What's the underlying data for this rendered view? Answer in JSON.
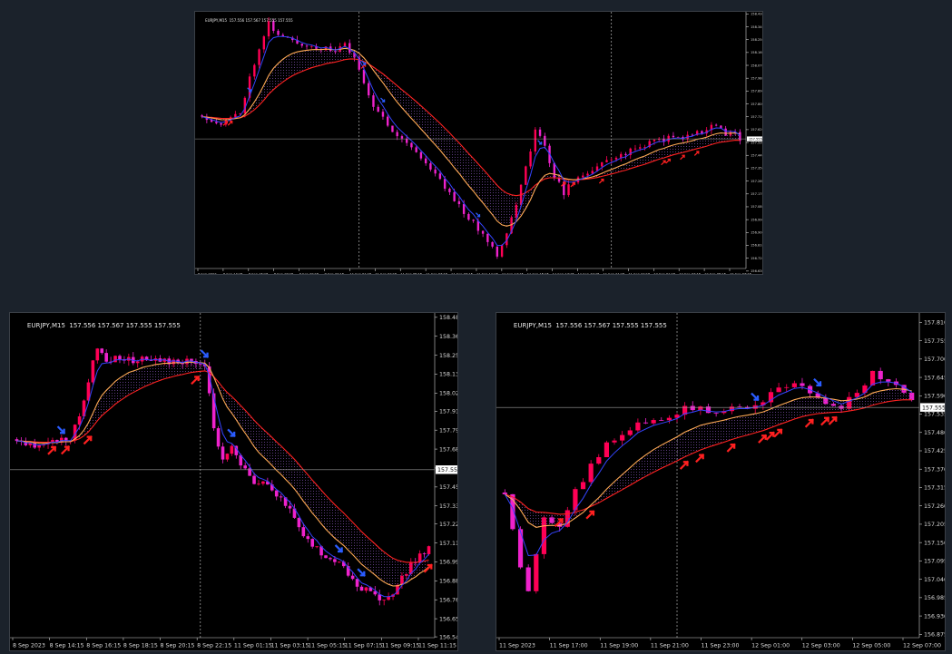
{
  "header": {
    "symbol": "EURJPY,M15",
    "quote": "157.556 157.567 157.555 157.555"
  },
  "colors": {
    "background": "#000000",
    "page": "#1b222b",
    "bull_candle": "#ff0055",
    "bear_candle": "#ee22cc",
    "ema_fast": "#3344ff",
    "ema_mid": "#ffaa55",
    "ema_slow": "#ff2222",
    "arrow_up": "#ff2020",
    "arrow_down": "#2a5cff",
    "price_line": "#9a9a9a",
    "separator": "#cfcfcf"
  },
  "chart_data": [
    {
      "type": "candlestick",
      "panel": "top",
      "title": "EURJPY,M15  157.556 157.567 157.555 157.555",
      "ylim": [
        156.648,
        158.432
      ],
      "yticks": [
        "158.430",
        "158.340",
        "158.250",
        "158.160",
        "158.070",
        "157.980",
        "157.890",
        "157.800",
        "157.710",
        "157.620",
        "157.530",
        "157.440",
        "157.350",
        "157.260",
        "157.170",
        "157.080",
        "156.990",
        "156.900",
        "156.810",
        "156.720",
        "156.630",
        "156.540"
      ],
      "xticks": [
        "8 Sep 2023",
        "8 Sep 14:15",
        "8 Sep 16:15",
        "8 Sep 18:15",
        "8 Sep 20:15",
        "8 Sep 22:15",
        "11 Sep 01:15",
        "11 Sep 03:15",
        "11 Sep 05:15",
        "11 Sep 07:15",
        "11 Sep 09:15",
        "11 Sep 11:15",
        "11 Sep 13:15",
        "11 Sep 15:15",
        "11 Sep 17:15",
        "11 Sep 19:15",
        "11 Sep 21:15",
        "11 Sep 23:15",
        "12 Sep 01:15",
        "12 Sep 03:15",
        "12 Sep 05:15",
        "12 Sep 07:15"
      ],
      "current_price": "157.555",
      "price_path": [
        [
          0,
          157.72
        ],
        [
          4,
          157.66
        ],
        [
          8,
          157.74
        ],
        [
          10,
          157.98
        ],
        [
          12,
          158.2
        ],
        [
          14,
          158.37
        ],
        [
          16,
          158.28
        ],
        [
          19,
          158.24
        ],
        [
          22,
          158.21
        ],
        [
          25,
          158.19
        ],
        [
          28,
          158.17
        ],
        [
          30,
          158.22
        ],
        [
          33,
          158.05
        ],
        [
          36,
          157.78
        ],
        [
          40,
          157.62
        ],
        [
          44,
          157.5
        ],
        [
          48,
          157.35
        ],
        [
          52,
          157.18
        ],
        [
          56,
          157.0
        ],
        [
          60,
          156.85
        ],
        [
          62,
          156.75
        ],
        [
          64,
          156.9
        ],
        [
          66,
          157.1
        ],
        [
          68,
          157.35
        ],
        [
          70,
          157.62
        ],
        [
          72,
          157.5
        ],
        [
          74,
          157.3
        ],
        [
          76,
          157.18
        ],
        [
          78,
          157.26
        ],
        [
          82,
          157.34
        ],
        [
          86,
          157.42
        ],
        [
          90,
          157.47
        ],
        [
          94,
          157.53
        ],
        [
          98,
          157.56
        ],
        [
          102,
          157.57
        ],
        [
          104,
          157.6
        ],
        [
          106,
          157.62
        ],
        [
          108,
          157.66
        ],
        [
          110,
          157.58
        ],
        [
          112,
          157.59
        ],
        [
          113,
          157.56
        ]
      ],
      "separators": [
        33,
        86
      ],
      "markers_up": [
        5,
        6,
        34,
        76,
        78,
        84,
        97,
        98,
        101,
        104
      ],
      "markers_down": [
        10,
        34,
        38,
        58,
        71
      ]
    },
    {
      "type": "candlestick",
      "panel": "bottom-left",
      "title": "EURJPY,M15  157.556 157.567 157.555 157.555",
      "ylim": [
        156.535,
        158.49
      ],
      "yticks": [
        "158.480",
        "158.365",
        "158.250",
        "158.135",
        "158.020",
        "157.910",
        "157.795",
        "157.680",
        "157.565",
        "157.450",
        "157.335",
        "157.225",
        "157.110",
        "156.995",
        "156.880",
        "156.765",
        "156.650",
        "156.540"
      ],
      "xticks": [
        "8 Sep 2023",
        "8 Sep 14:15",
        "8 Sep 16:15",
        "8 Sep 18:15",
        "8 Sep 20:15",
        "8 Sep 22:15",
        "11 Sep 01:15",
        "11 Sep 03:15",
        "11 Sep 05:15",
        "11 Sep 07:15",
        "11 Sep 09:15",
        "11 Sep 11:15"
      ],
      "current_price": "157.555",
      "price_path": [
        [
          0,
          157.74
        ],
        [
          3,
          157.7
        ],
        [
          6,
          157.72
        ],
        [
          9,
          157.73
        ],
        [
          12,
          157.74
        ],
        [
          14,
          157.88
        ],
        [
          16,
          158.1
        ],
        [
          18,
          158.3
        ],
        [
          20,
          158.23
        ],
        [
          24,
          158.22
        ],
        [
          28,
          158.22
        ],
        [
          32,
          158.21
        ],
        [
          36,
          158.22
        ],
        [
          40,
          158.2
        ],
        [
          42,
          158.2
        ],
        [
          44,
          157.8
        ],
        [
          46,
          157.6
        ],
        [
          48,
          157.7
        ],
        [
          50,
          157.6
        ],
        [
          52,
          157.5
        ],
        [
          56,
          157.45
        ],
        [
          60,
          157.35
        ],
        [
          64,
          157.15
        ],
        [
          68,
          157.05
        ],
        [
          72,
          157.0
        ],
        [
          76,
          156.85
        ],
        [
          78,
          156.82
        ],
        [
          80,
          156.78
        ],
        [
          82,
          156.75
        ],
        [
          84,
          156.8
        ],
        [
          86,
          156.9
        ],
        [
          88,
          156.98
        ],
        [
          90,
          157.03
        ],
        [
          92,
          157.08
        ]
      ],
      "separators": [
        41
      ],
      "markers_up": [
        8,
        11,
        16,
        40,
        92
      ],
      "markers_down": [
        10,
        42,
        48,
        72,
        77
      ]
    },
    {
      "type": "candlestick",
      "panel": "bottom-right",
      "title": "EURJPY,M15  157.556 157.567 157.555 157.555",
      "ylim": [
        156.865,
        157.83
      ],
      "yticks": [
        "157.810",
        "157.755",
        "157.700",
        "157.645",
        "157.590",
        "157.535",
        "157.480",
        "157.425",
        "157.370",
        "157.315",
        "157.260",
        "157.205",
        "157.150",
        "157.095",
        "157.040",
        "156.985",
        "156.930",
        "156.875"
      ],
      "xticks": [
        "11 Sep 2023",
        "11 Sep 17:00",
        "11 Sep 19:00",
        "11 Sep 21:00",
        "11 Sep 23:00",
        "12 Sep 01:00",
        "12 Sep 03:00",
        "12 Sep 05:00",
        "12 Sep 07:00"
      ],
      "current_price": "157.555",
      "price_path": [
        [
          0,
          157.3
        ],
        [
          1,
          157.2
        ],
        [
          2,
          157.08
        ],
        [
          3,
          157.0
        ],
        [
          5,
          157.22
        ],
        [
          7,
          157.2
        ],
        [
          9,
          157.3
        ],
        [
          11,
          157.38
        ],
        [
          13,
          157.44
        ],
        [
          15,
          157.48
        ],
        [
          17,
          157.5
        ],
        [
          19,
          157.52
        ],
        [
          21,
          157.53
        ],
        [
          23,
          157.55
        ],
        [
          25,
          157.55
        ],
        [
          27,
          157.54
        ],
        [
          29,
          157.55
        ],
        [
          31,
          157.56
        ],
        [
          33,
          157.57
        ],
        [
          35,
          157.62
        ],
        [
          37,
          157.62
        ],
        [
          39,
          157.6
        ],
        [
          41,
          157.56
        ],
        [
          43,
          157.56
        ],
        [
          45,
          157.6
        ],
        [
          47,
          157.66
        ],
        [
          49,
          157.63
        ],
        [
          51,
          157.6
        ],
        [
          52,
          157.57
        ]
      ],
      "separators": [
        22
      ],
      "markers_up": [
        7,
        11,
        23,
        25,
        29,
        33,
        34,
        35,
        39,
        41,
        42
      ],
      "markers_down": [
        32,
        40
      ]
    }
  ]
}
